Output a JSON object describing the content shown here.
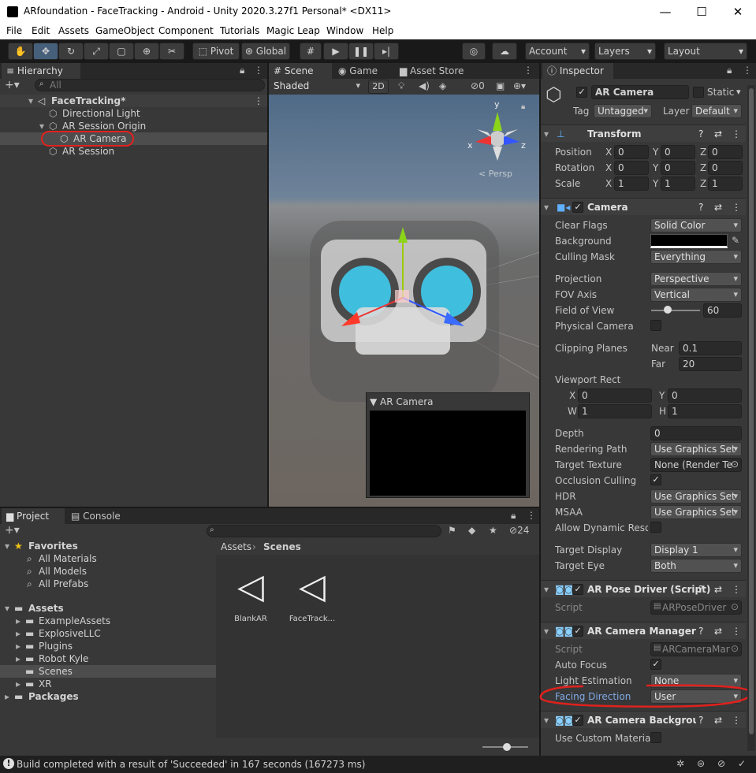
{
  "window": {
    "title": "ARfoundation - FaceTracking - Android - Unity 2020.3.27f1 Personal* <DX11>",
    "minimize": "—",
    "maximize": "☐",
    "close": "✕"
  },
  "menu": [
    "File",
    "Edit",
    "Assets",
    "GameObject",
    "Component",
    "Tutorials",
    "Magic Leap",
    "Window",
    "Help"
  ],
  "toolbar": {
    "pivot": "Pivot",
    "global": "Global",
    "account": "Account",
    "layers": "Layers",
    "layout": "Layout"
  },
  "hierarchy": {
    "tab": "Hierarchy",
    "search_placeholder": "All",
    "scene": "FaceTracking*",
    "items": [
      "Directional Light",
      "AR Session Origin",
      "AR Camera",
      "AR Session"
    ]
  },
  "scene": {
    "tabs": [
      "Scene",
      "Game",
      "Asset Store"
    ],
    "shading": "Shaded",
    "mode2d": "2D",
    "hidden_count": "0",
    "gizmo_axes": {
      "x": "x",
      "y": "y",
      "z": "z"
    },
    "persp": "< Persp",
    "preview_title": "AR Camera"
  },
  "project": {
    "tabs": [
      "Project",
      "Console"
    ],
    "favorites": {
      "label": "Favorites",
      "items": [
        "All Materials",
        "All Models",
        "All Prefabs"
      ]
    },
    "assets": {
      "label": "Assets",
      "items": [
        "ExampleAssets",
        "ExplosiveLLC",
        "Plugins",
        "Robot Kyle",
        "Scenes",
        "XR"
      ]
    },
    "packages": "Packages",
    "breadcrumb": [
      "Assets",
      "Scenes"
    ],
    "files": [
      "BlankAR",
      "FaceTrack..."
    ],
    "hidden_count": "24"
  },
  "inspector": {
    "tab": "Inspector",
    "name": "AR Camera",
    "static": "Static",
    "tag_label": "Tag",
    "tag": "Untagged",
    "layer_label": "Layer",
    "layer": "Default",
    "transform": {
      "title": "Transform",
      "rows": [
        {
          "label": "Position",
          "x": "0",
          "y": "0",
          "z": "0"
        },
        {
          "label": "Rotation",
          "x": "0",
          "y": "0",
          "z": "0"
        },
        {
          "label": "Scale",
          "x": "1",
          "y": "1",
          "z": "1"
        }
      ],
      "axis": {
        "x": "X",
        "y": "Y",
        "z": "Z"
      }
    },
    "camera": {
      "title": "Camera",
      "clear_flags_label": "Clear Flags",
      "clear_flags": "Solid Color",
      "background_label": "Background",
      "culling_label": "Culling Mask",
      "culling": "Everything",
      "projection_label": "Projection",
      "projection": "Perspective",
      "fov_axis_label": "FOV Axis",
      "fov_axis": "Vertical",
      "fov_label": "Field of View",
      "fov": "60",
      "physical_label": "Physical Camera",
      "clipping_label": "Clipping Planes",
      "near_label": "Near",
      "near": "0.1",
      "far_label": "Far",
      "far": "20",
      "viewport_label": "Viewport Rect",
      "vx_label": "X",
      "vx": "0",
      "vy_label": "Y",
      "vy": "0",
      "vw_label": "W",
      "vw": "1",
      "vh_label": "H",
      "vh": "1",
      "depth_label": "Depth",
      "depth": "0",
      "rendering_label": "Rendering Path",
      "rendering": "Use Graphics Set",
      "target_tex_label": "Target Texture",
      "target_tex": "None (Render Te",
      "occlusion_label": "Occlusion Culling",
      "hdr_label": "HDR",
      "hdr": "Use Graphics Set",
      "msaa_label": "MSAA",
      "msaa": "Use Graphics Set",
      "dynres_label": "Allow Dynamic Resol",
      "display_label": "Target Display",
      "display": "Display 1",
      "eye_label": "Target Eye",
      "eye": "Both"
    },
    "pose_driver": {
      "title": "AR Pose Driver (Script)",
      "script_label": "Script",
      "script": "ARPoseDriver"
    },
    "cam_manager": {
      "title": "AR Camera Manager (S",
      "script_label": "Script",
      "script": "ARCameraMar",
      "autofocus_label": "Auto Focus",
      "light_label": "Light Estimation",
      "light": "None",
      "facing_label": "Facing Direction",
      "facing": "User"
    },
    "background": {
      "title": "AR Camera Backgrounc",
      "custom_label": "Use Custom Material"
    }
  },
  "status": {
    "message": "Build completed with a result of 'Succeeded' in 167 seconds (167273 ms)"
  },
  "colors": {
    "annotation": "#e0211d",
    "selection": "#2c5d87",
    "facing_label": "#7faae6"
  }
}
